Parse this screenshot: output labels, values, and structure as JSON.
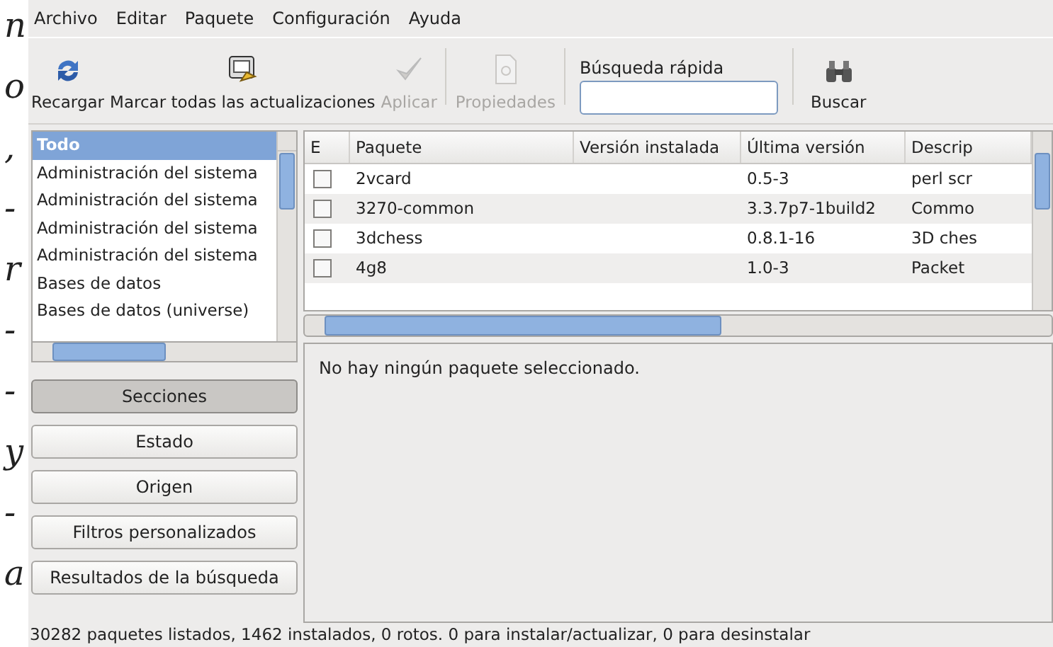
{
  "background_text": [
    "n",
    "o",
    ",",
    "-",
    "r",
    "-",
    "-",
    "y",
    "-",
    "a"
  ],
  "menu": [
    "Archivo",
    "Editar",
    "Paquete",
    "Configuración",
    "Ayuda"
  ],
  "toolbar": [
    {
      "kind": "reload",
      "label": "Recargar",
      "disabled": false
    },
    {
      "kind": "mark",
      "label": "Marcar todas las actualizaciones",
      "disabled": false
    },
    {
      "kind": "apply",
      "label": "Aplicar",
      "disabled": true
    },
    {
      "kind": "properties",
      "label": "Propiedades",
      "disabled": true
    }
  ],
  "quick_search": {
    "label": "Búsqueda rápida",
    "button": "Buscar"
  },
  "sections": [
    {
      "label": "Todo",
      "selected": true
    },
    {
      "label": "Administración del sistema",
      "selected": false
    },
    {
      "label": "Administración del sistema",
      "selected": false
    },
    {
      "label": "Administración del sistema",
      "selected": false
    },
    {
      "label": "Administración del sistema",
      "selected": false
    },
    {
      "label": "Bases de datos",
      "selected": false
    },
    {
      "label": "Bases de datos (universe)",
      "selected": false
    }
  ],
  "filter_buttons": [
    {
      "label": "Secciones",
      "selected": true
    },
    {
      "label": "Estado",
      "selected": false
    },
    {
      "label": "Origen",
      "selected": false
    },
    {
      "label": "Filtros personalizados",
      "selected": false
    },
    {
      "label": "Resultados de la búsqueda",
      "selected": false
    }
  ],
  "table": {
    "columns": [
      "E",
      "Paquete",
      "Versión instalada",
      "Última versión",
      "Descrip"
    ],
    "rows": [
      {
        "checked": false,
        "package": "2vcard",
        "installed": "",
        "latest": "0.5-3",
        "description": "perl scr"
      },
      {
        "checked": false,
        "package": "3270-common",
        "installed": "",
        "latest": "3.3.7p7-1build2",
        "description": "Commo"
      },
      {
        "checked": false,
        "package": "3dchess",
        "installed": "",
        "latest": "0.8.1-16",
        "description": "3D ches"
      },
      {
        "checked": false,
        "package": "4g8",
        "installed": "",
        "latest": "1.0-3",
        "description": "Packet"
      }
    ]
  },
  "details": "No hay ningún paquete seleccionado.",
  "status_bar": "30282 paquetes listados, 1462 instalados, 0 rotos. 0 para instalar/actualizar, 0 para desinstalar"
}
